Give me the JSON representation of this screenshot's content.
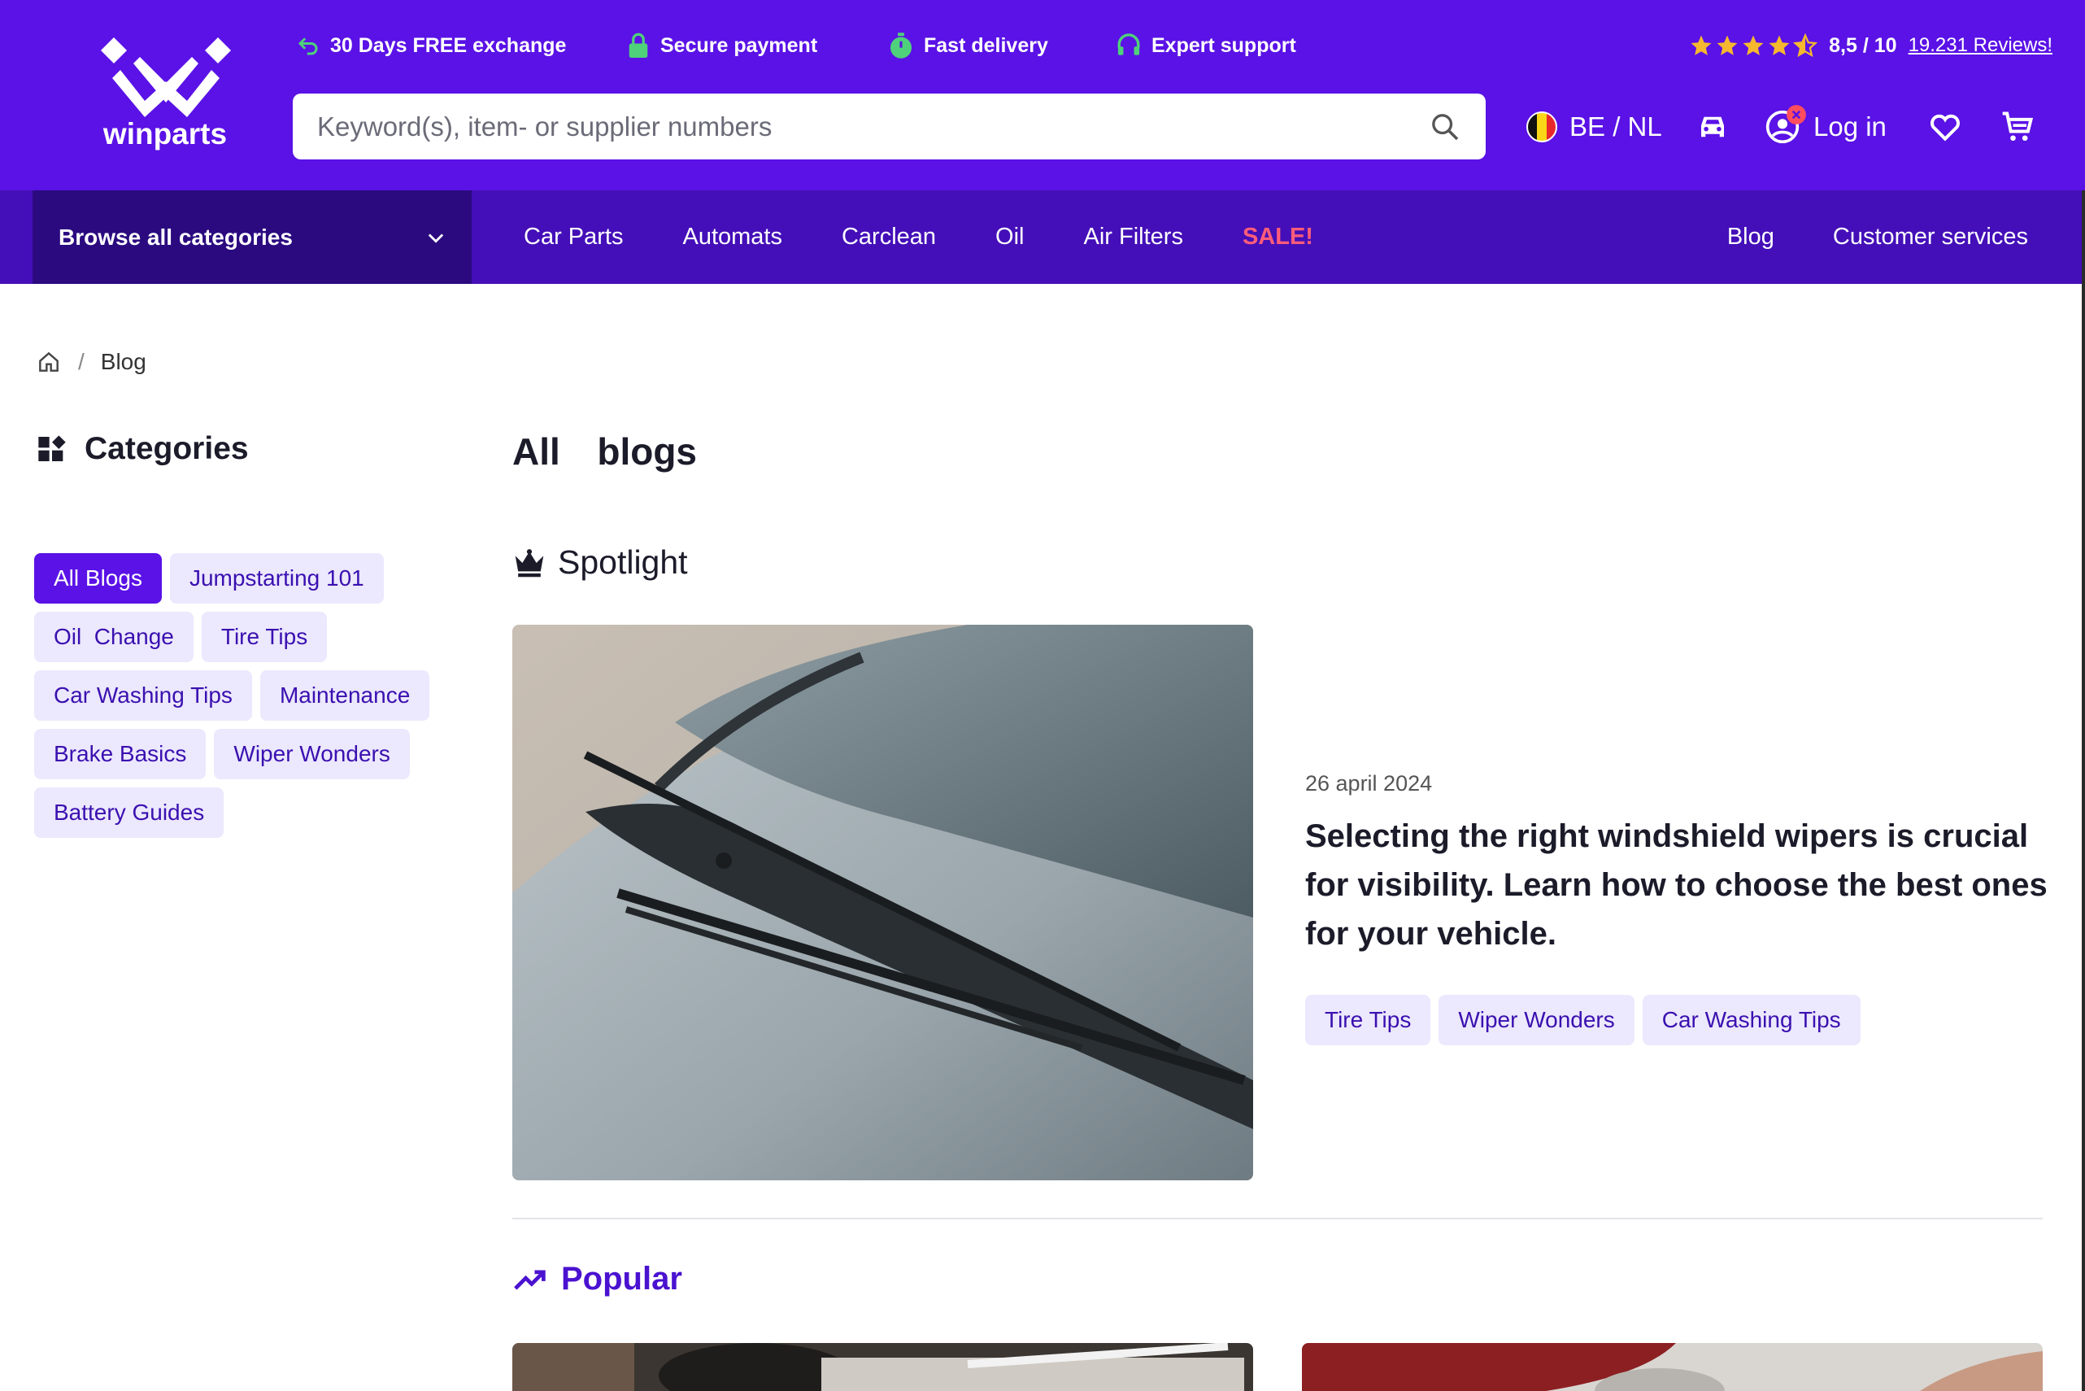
{
  "brand": {
    "name": "winparts"
  },
  "usps": [
    {
      "label": "30 Days FREE exchange",
      "icon": "return-icon"
    },
    {
      "label": "Secure payment",
      "icon": "lock-icon"
    },
    {
      "label": "Fast delivery",
      "icon": "stopwatch-icon"
    },
    {
      "label": "Expert support",
      "icon": "headset-icon"
    }
  ],
  "rating": {
    "stars": 4.5,
    "score": "8,5 / 10",
    "reviews_link": "19.231 Reviews!"
  },
  "search": {
    "placeholder": "Keyword(s), item- or supplier numbers"
  },
  "header": {
    "locale": "BE / NL",
    "login": "Log in"
  },
  "nav": {
    "browse": "Browse all categories",
    "links": [
      "Car Parts",
      "Automats",
      "Carclean",
      "Oil",
      "Air Filters",
      "SALE!"
    ],
    "right": [
      "Blog",
      "Customer services"
    ]
  },
  "breadcrumb": {
    "current": "Blog"
  },
  "sidebar": {
    "title": "Categories",
    "tags": [
      "All Blogs",
      "Jumpstarting 101",
      "Oil  Change",
      "Tire Tips",
      "Car Washing Tips",
      "Maintenance",
      "Brake Basics",
      "Wiper Wonders",
      "Battery Guides"
    ],
    "active": "All Blogs"
  },
  "main": {
    "title": "All  blogs",
    "spotlight_label": "Spotlight",
    "spotlight": {
      "date": "26 april 2024",
      "headline": "Selecting the right windshield wipers is crucial for visibility. Learn how to choose the best ones for your vehicle.",
      "tags": [
        "Tire Tips",
        "Wiper Wonders",
        "Car Washing Tips"
      ]
    },
    "popular_label": "Popular"
  },
  "colors": {
    "brand": "#5a12e6",
    "nav": "#440fb8",
    "browse": "#2b0a80",
    "tag_bg": "#ece8fd",
    "sale": "#ff5c7a",
    "usp_icon": "#4ed17a",
    "star": "#f5b82e"
  }
}
